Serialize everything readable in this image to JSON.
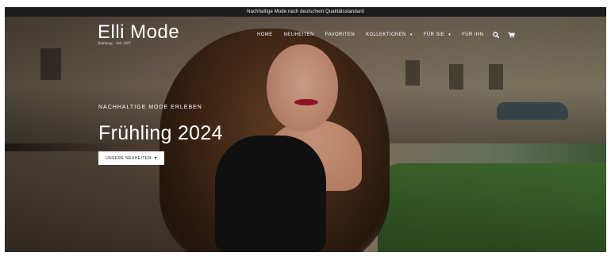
{
  "announcement": "Nachhaltige Mode nach deutschem Qualitätsstandard",
  "brand": {
    "name": "Elli Mode",
    "tagline": "Hamburg · Seit 2007"
  },
  "nav": {
    "items": [
      {
        "label": "HOME",
        "dropdown": false
      },
      {
        "label": "NEUHEITEN",
        "dropdown": false
      },
      {
        "label": "FAVORITEN",
        "dropdown": false
      },
      {
        "label": "KOLLEKTIONEN",
        "dropdown": true
      },
      {
        "label": "FÜR SIE",
        "dropdown": true
      },
      {
        "label": "FÜR IHN",
        "dropdown": false
      }
    ],
    "icons": [
      "search-icon",
      "cart-icon"
    ]
  },
  "hero": {
    "eyebrow": "NACHHALTIGE MODE ERLEBEN",
    "headline": "Frühling 2024",
    "cta_label": "UNSERE NEUHEITEN",
    "cta_icon": "chevron-down-icon"
  },
  "colors": {
    "bar": "#1d1d1d",
    "text_light": "#ffffff",
    "button_bg": "#ffffff",
    "button_text": "#222222"
  }
}
